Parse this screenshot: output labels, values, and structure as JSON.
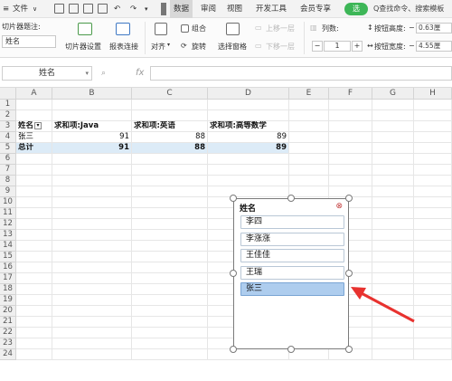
{
  "menubar": {
    "file_label": "文件",
    "tabs": [
      "数据",
      "审阅",
      "视图",
      "开发工具",
      "会员专享"
    ],
    "share_label": "选",
    "search_text": "Q查找命令、搜索模板"
  },
  "ribbon": {
    "caption_label": "切片器题注:",
    "caption_value": "姓名",
    "slicer_settings": "切片器设置",
    "report_connections": "报表连接",
    "align": "对齐",
    "group": "组合",
    "rotate": "旋转",
    "selection_pane": "选择窗格",
    "bring_forward": "上移一层",
    "send_backward": "下移一层",
    "columns_label": "列数:",
    "columns_value": "1",
    "button_height_label": "按钮高度:",
    "button_height_value": "0.63厘",
    "button_width_label": "按钮宽度:",
    "button_width_value": "4.55厘"
  },
  "formula_bar": {
    "name_box": "姓名",
    "zoom_icon": "magnifier-icon",
    "fx_label": "fx",
    "formula": ""
  },
  "sheet": {
    "columns": [
      "A",
      "B",
      "C",
      "D",
      "E",
      "F",
      "G",
      "H"
    ],
    "rows": [
      "1",
      "2",
      "3",
      "4",
      "5",
      "6",
      "7",
      "8",
      "9",
      "10",
      "11",
      "12",
      "13",
      "14",
      "15",
      "16",
      "17",
      "18",
      "19",
      "20",
      "21",
      "22",
      "23",
      "24"
    ],
    "pivot": {
      "headers": [
        "姓名",
        "求和项:Java",
        "求和项:英语",
        "求和项:高等数学"
      ],
      "row": [
        "张三",
        "91",
        "88",
        "89"
      ],
      "total": [
        "总计",
        "91",
        "88",
        "89"
      ]
    }
  },
  "slicer": {
    "title": "姓名",
    "clear_icon": "clear-filter-icon",
    "items": [
      "李四",
      "李涨涨",
      "王佳佳",
      "王瑞",
      "张三"
    ],
    "selected": "张三"
  },
  "colors": {
    "total_fill": "#dcebf7",
    "selected_item": "#aecdee",
    "annotation_arrow": "#e8322f",
    "share_pill": "#3db657"
  }
}
